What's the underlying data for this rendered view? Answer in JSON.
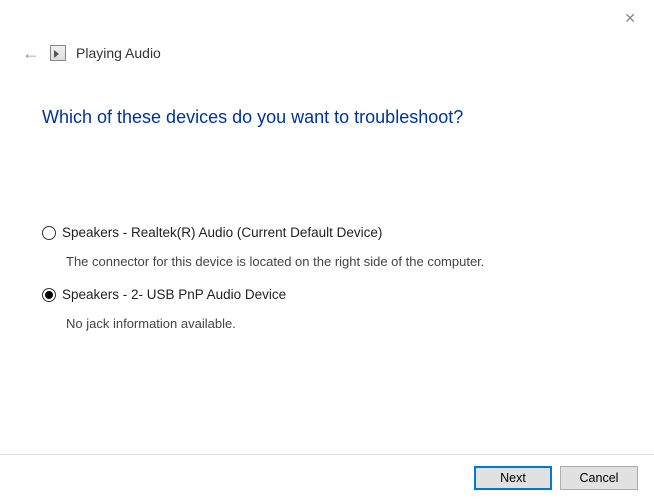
{
  "window": {
    "close_glyph": "✕"
  },
  "header": {
    "back_glyph": "←",
    "title": "Playing Audio"
  },
  "main": {
    "heading": "Which of these devices do you want to troubleshoot?"
  },
  "options": [
    {
      "label": "Speakers - Realtek(R) Audio (Current Default Device)",
      "description": "The connector for this device is located on the right side of the computer.",
      "selected": false
    },
    {
      "label": "Speakers - 2- USB PnP Audio Device",
      "description": "No jack information available.",
      "selected": true
    }
  ],
  "footer": {
    "next_label": "Next",
    "cancel_label": "Cancel"
  }
}
